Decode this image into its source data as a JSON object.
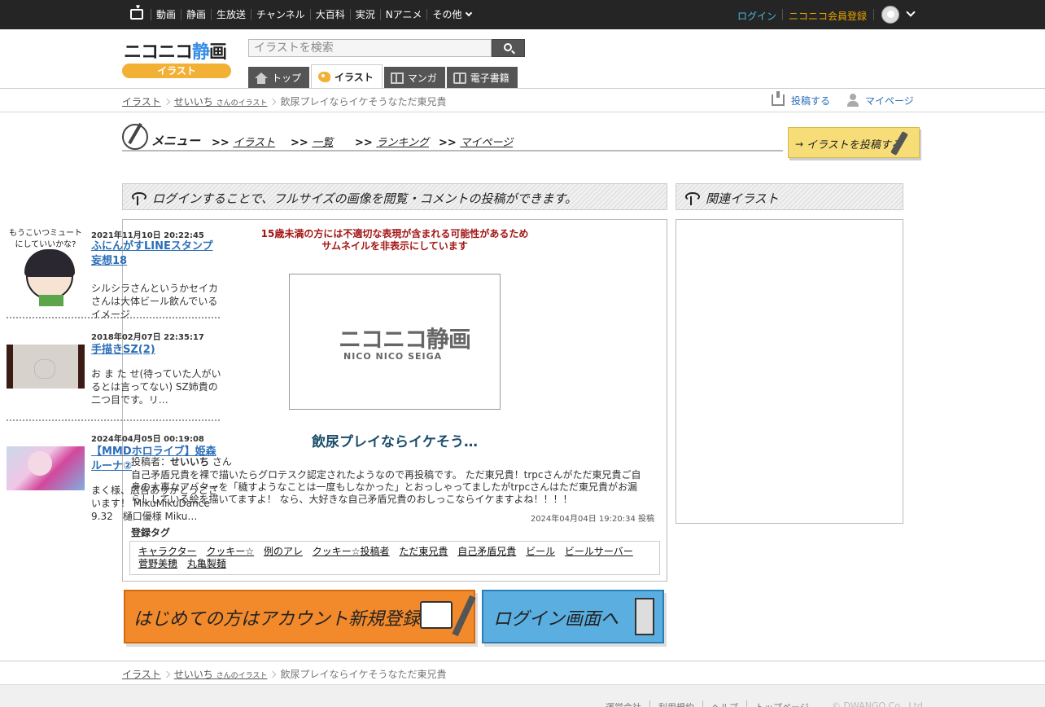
{
  "topbar": {
    "nav": [
      "動画",
      "静画",
      "生放送",
      "チャンネル",
      "大百科",
      "実況",
      "Nアニメ",
      "その他"
    ],
    "login": "ログイン",
    "register": "ニコニコ会員登録"
  },
  "header": {
    "logo_main_a": "ニコニコ",
    "logo_main_b": "静",
    "logo_main_c": "画",
    "logo_sub": "イラスト",
    "search_placeholder": "イラストを検索",
    "tabs": [
      {
        "label": "トップ"
      },
      {
        "label": "イラスト"
      },
      {
        "label": "マンガ"
      },
      {
        "label": "電子書籍"
      }
    ]
  },
  "breadcrumb": {
    "root": "イラスト",
    "user": "せいいち",
    "user_suffix": "さんのイラスト",
    "current": "飲尿プレイならイケそうなただ東兄貴"
  },
  "actions": {
    "post": "投稿する",
    "mypage": "マイページ"
  },
  "menu": {
    "title": "メニュー",
    "items": [
      ">>",
      "イラスト",
      ">>",
      "一覧",
      ">>",
      "ランキング",
      ">>",
      "マイページ"
    ],
    "post_button": "イラストを投稿する",
    "post_arrow": "→"
  },
  "main": {
    "header": "ログインすることで、フルサイズの画像を閲覧・コメントの投稿ができます。",
    "warning_line1": "15歳未満の方には不適切な表現が含まれる可能性があるため",
    "warning_line2": "サムネイルを非表示にしています",
    "placeholder_logo_a": "ニコニコ",
    "placeholder_logo_b": "静画",
    "placeholder_sub": "NICO NICO SEIGA",
    "title": "飲尿プレイならイケそう…",
    "poster_label": "投稿者：",
    "poster_name": "せいいち",
    "poster_suffix": " さん",
    "description": "自己矛盾兄貴を裸で描いたらグロテスク認定されたようなので再投稿です。 ただ東兄貴！trpcさんがただ東兄貴ご自身の大事なアバターを「穢すようなことは一度もしなかった」とおっしゃってましたがtrpcさんはただ東兄貴がお漏らししている絵を描いてますよ！ なら、大好きな自己矛盾兄貴のおしっこならイケますよね！！！！",
    "post_date": "2024年04月04日 19:20:34 投稿",
    "tags_label": "登録タグ",
    "tags": [
      "キャラクター",
      "クッキー☆",
      "例のアレ",
      "クッキー☆投稿者",
      "ただ東兄貴",
      "自己矛盾兄貴",
      "ビール",
      "ビールサーバー",
      "菅野美穂",
      "丸亀製麺"
    ]
  },
  "cta": {
    "register": "はじめての方はアカウント新規登録へ",
    "login": "ログイン画面へ"
  },
  "related": {
    "header": "関連イラスト",
    "items": [
      {
        "caption": "もうこいつミュートにしていいかな?",
        "date": "2021年11月10日 20:22:45",
        "title": "ふにんがすLINEスタンプ妄想18",
        "desc": "シルシラさんというかセイカさんは大体ビール飲んでいるイメージ"
      },
      {
        "date": "2018年02月07日 22:35:17",
        "title": "手描きSZ(2)",
        "desc": "お ま た せ(待っていた人がいるとは言ってない) SZ姉貴の二つ目です。リ…"
      },
      {
        "date": "2024年04月05日 00:19:08",
        "title": "【MMDホロライブ】姫森ルーナ②",
        "desc": "まく様、広告ありがとうございます！ MikuMikuDance 9.32　樋口優様 Miku…"
      }
    ]
  },
  "footer": {
    "links": [
      "運営会社",
      "利用規約",
      "ヘルプ",
      "トップページ"
    ],
    "copyright": "© DWANGO Co., Ltd."
  }
}
